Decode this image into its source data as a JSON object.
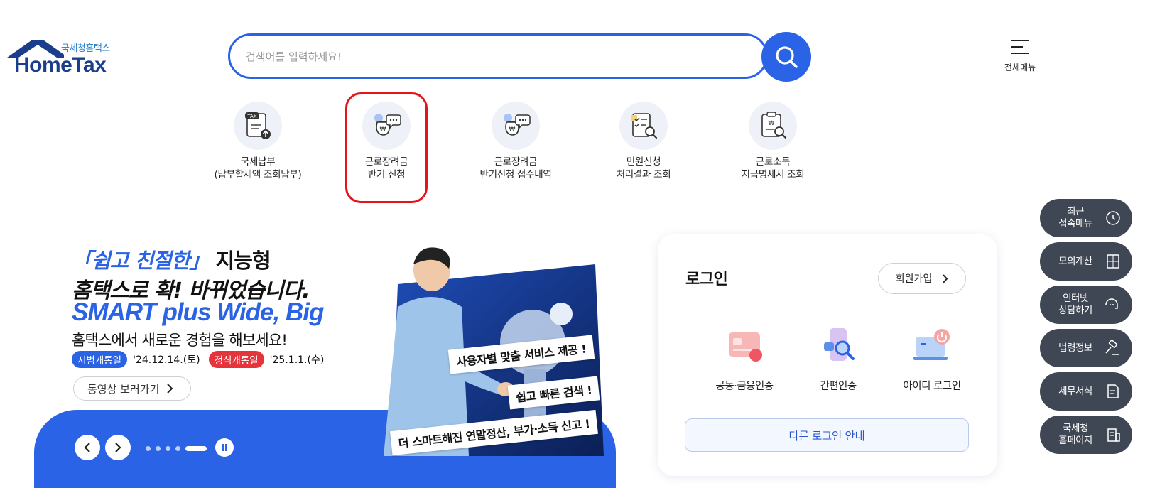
{
  "header": {
    "logo_sub": "국세청홈택스",
    "logo_main": "HomeTax",
    "search_placeholder": "검색어를 입력하세요!",
    "menu_label": "전체메뉴"
  },
  "quick_menu": [
    {
      "line1": "국세납부",
      "line2": "(납부할세액 조회납부)",
      "icon": "tax-payment-icon"
    },
    {
      "line1": "근로장려금",
      "line2": "반기 신청",
      "icon": "incentive-apply-icon"
    },
    {
      "line1": "근로장려금",
      "line2": "반기신청 접수내역",
      "icon": "incentive-receipt-icon"
    },
    {
      "line1": "민원신청",
      "line2": "처리결과 조회",
      "icon": "civil-result-icon"
    },
    {
      "line1": "근로소득",
      "line2": "지급명세서 조회",
      "icon": "income-statement-icon"
    }
  ],
  "banner": {
    "line1_highlight": "「쉽고 친절한」",
    "line1_rest": " 지능형",
    "line2": "홈택스로 확! 바뀌었습니다.",
    "line3": "SMART plus Wide, Big",
    "line4": "홈택스에서 새로운 경험을 해보세요!",
    "badge1": "시범개통일",
    "date1": "'24.12.14.(토)",
    "badge2": "정식개통일",
    "date2": "'25.1.1.(수)",
    "video_button": "동영상 보러가기",
    "tag1": "사용자별 맞춤 서비스 제공 !",
    "tag2": "쉽고 빠른 검색 !",
    "tag3": "더 스마트해진 연말정산, 부가·소득 신고 !",
    "slides_total": 5,
    "slide_active": 5
  },
  "login": {
    "title": "로그인",
    "signup": "회원가입",
    "options": [
      "공동·금융인증",
      "간편인증",
      "아이디 로그인"
    ],
    "other": "다른 로그인 안내"
  },
  "side_menu": [
    {
      "label": "최근\n접속메뉴",
      "icon": "clock-icon"
    },
    {
      "label": "모의계산",
      "icon": "calculator-icon"
    },
    {
      "label": "인터넷\n상담하기",
      "icon": "chat-icon"
    },
    {
      "label": "법령정보",
      "icon": "gavel-icon"
    },
    {
      "label": "세무서식",
      "icon": "document-icon"
    },
    {
      "label": "국세청\n홈페이지",
      "icon": "building-icon"
    }
  ],
  "colors": {
    "primary": "#2a63e6",
    "highlight": "#e5141b",
    "side": "#3f4754"
  }
}
